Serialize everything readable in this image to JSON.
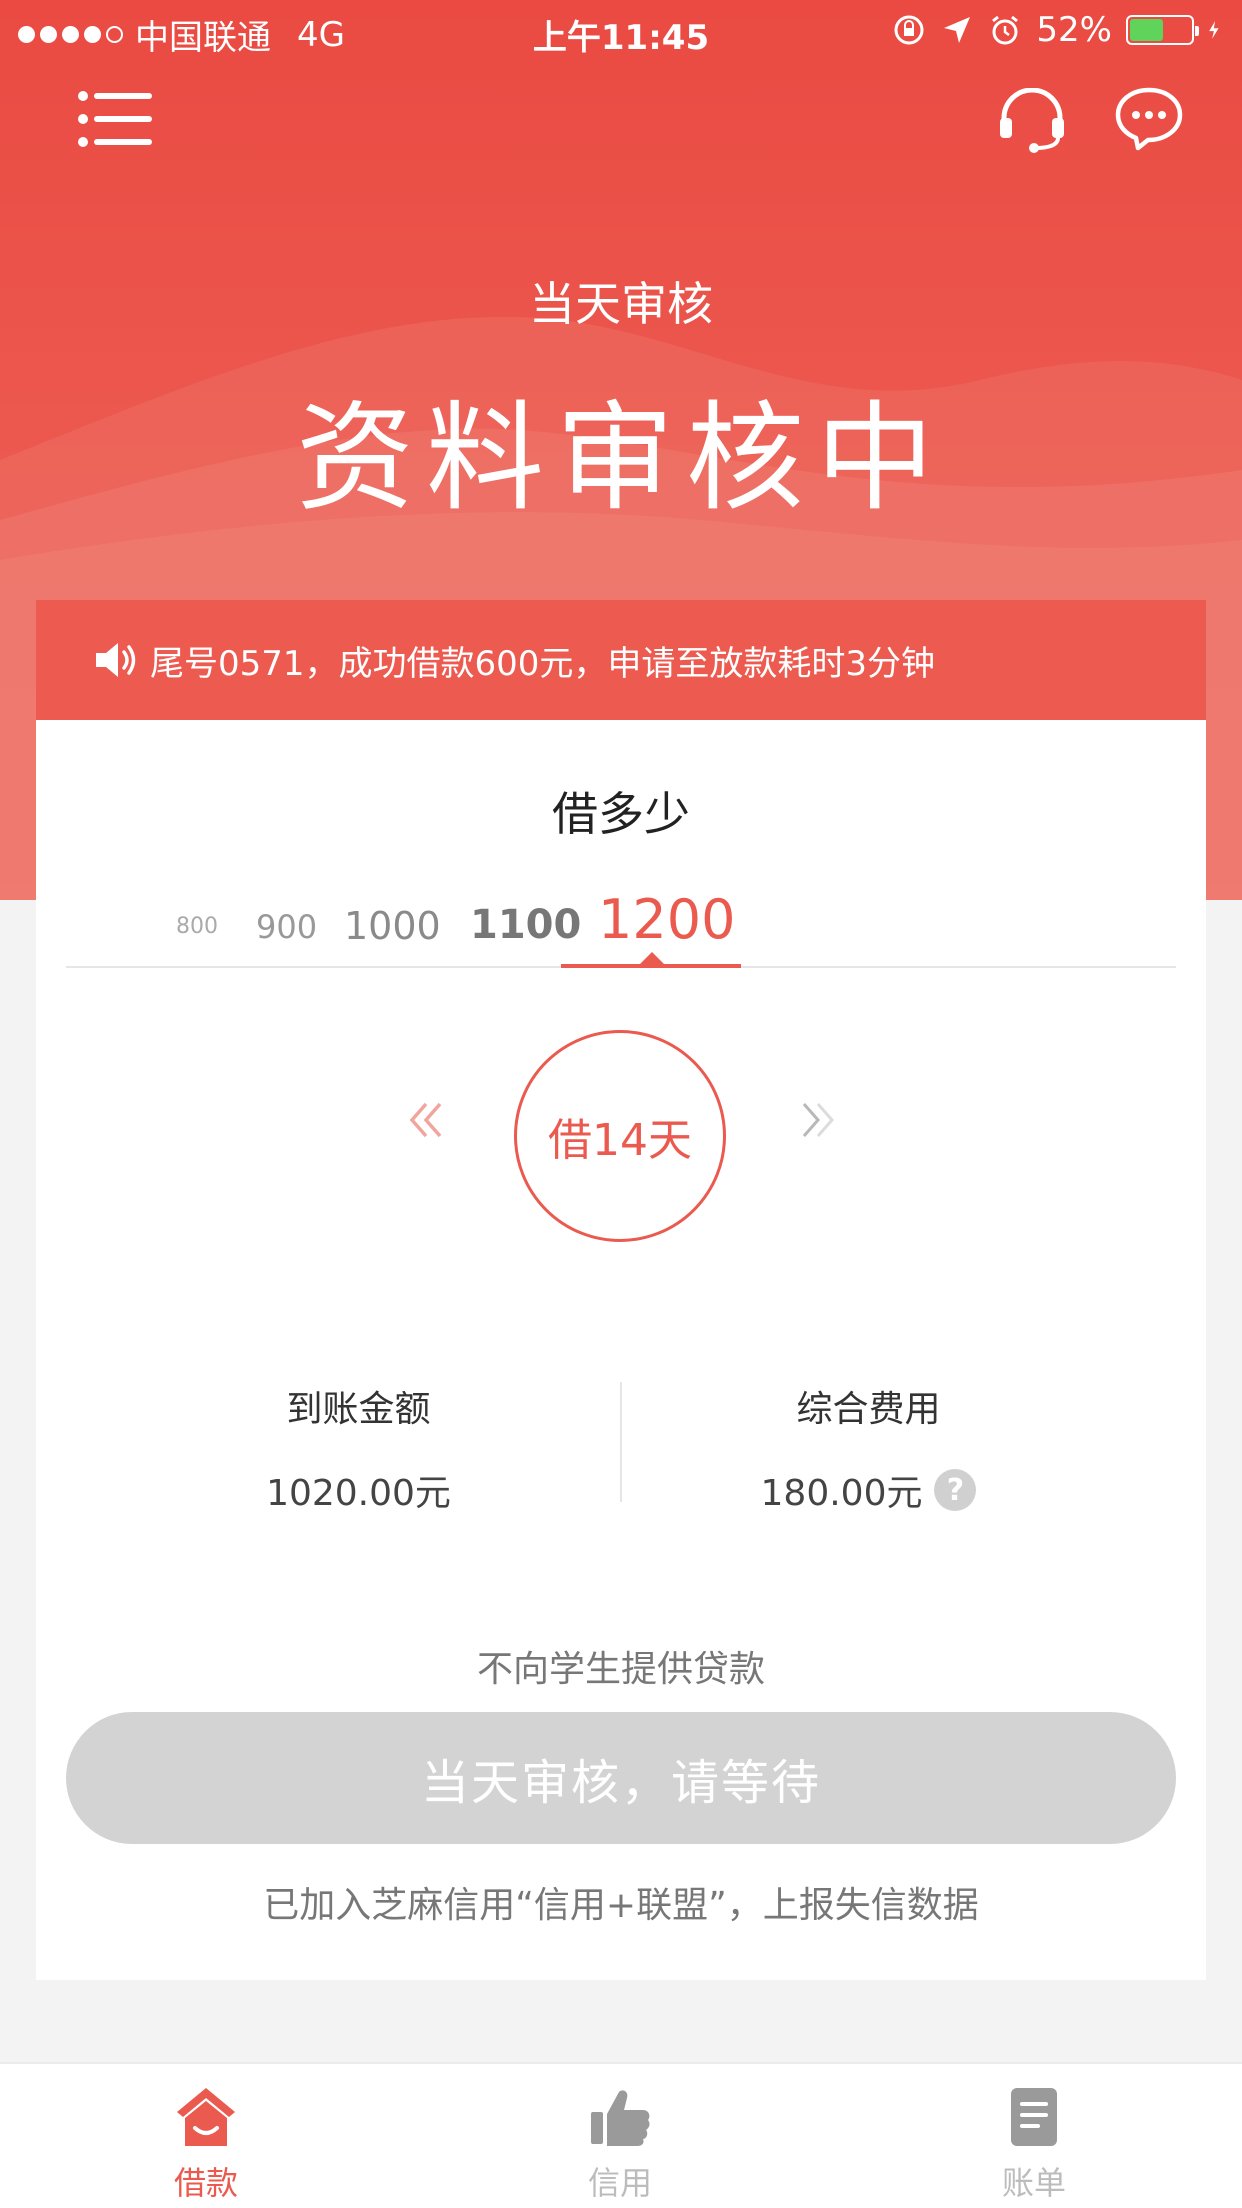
{
  "status_bar": {
    "carrier": "中国联通",
    "network": "4G",
    "time": "上午11:45",
    "battery": "52%",
    "battery_level": 0.52,
    "battery_color": "#5fd35a"
  },
  "nav": {
    "menu_icon": "menu-icon",
    "service_icon": "headset-icon",
    "message_icon": "chat-icon"
  },
  "hero": {
    "subtitle": "当天审核",
    "title": "资料审核中"
  },
  "notice": {
    "icon": "speaker-icon",
    "text": "尾号0571，成功借款600元，申请至放款耗时3分钟"
  },
  "amount": {
    "title": "借多少",
    "options": [
      "800",
      "900",
      "1000",
      "1100",
      "1200"
    ],
    "selected": "1200"
  },
  "term": {
    "label": "借14天"
  },
  "stats": {
    "received_label": "到账金额",
    "received_value": "1020.00元",
    "fee_label": "综合费用",
    "fee_value": "180.00元",
    "help_symbol": "?"
  },
  "notes": {
    "no_student": "不向学生提供贷款",
    "button": "当天审核，请等待",
    "footer": "已加入芝麻信用“信用+联盟”，上报失信数据"
  },
  "tabs": [
    {
      "label": "借款",
      "icon": "home-smile-icon",
      "active": true
    },
    {
      "label": "信用",
      "icon": "thumbs-up-icon",
      "active": false
    },
    {
      "label": "账单",
      "icon": "document-icon",
      "active": false
    }
  ],
  "colors": {
    "brand_red": "#ea4a42",
    "accent": "#ea5a4f",
    "disabled_button": "#d3d3d3"
  }
}
